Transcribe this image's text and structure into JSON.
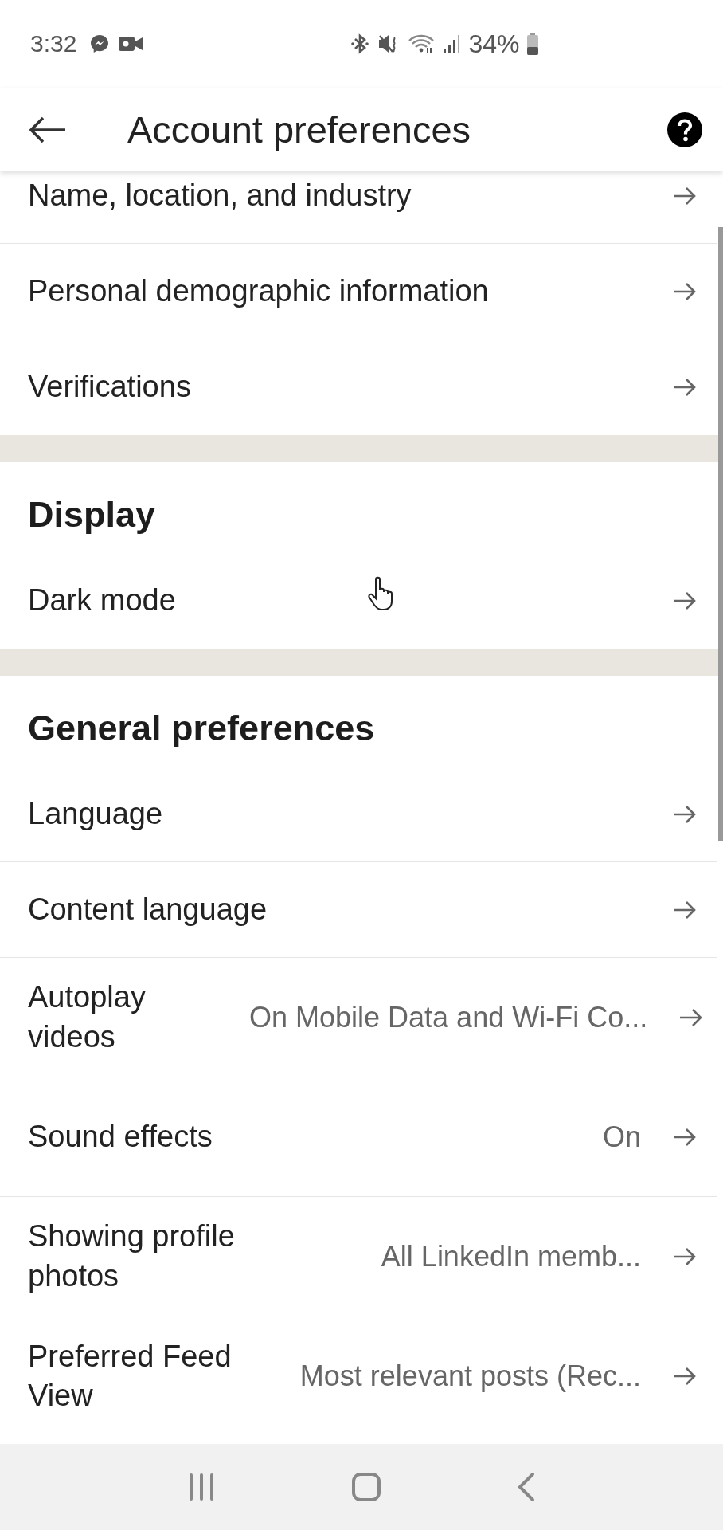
{
  "status_bar": {
    "time": "3:32",
    "battery": "34%"
  },
  "header": {
    "title": "Account preferences"
  },
  "sections": [
    {
      "items": [
        {
          "label": "Name, location, and industry"
        },
        {
          "label": "Personal demographic information"
        },
        {
          "label": "Verifications"
        }
      ]
    },
    {
      "heading": "Display",
      "items": [
        {
          "label": "Dark mode"
        }
      ]
    },
    {
      "heading": "General preferences",
      "items": [
        {
          "label": "Language"
        },
        {
          "label": "Content language"
        },
        {
          "label": "Autoplay videos",
          "value": "On Mobile Data and Wi-Fi Co..."
        },
        {
          "label": "Sound effects",
          "value": "On"
        },
        {
          "label": "Showing profile photos",
          "value": "All LinkedIn memb..."
        },
        {
          "label": "Preferred Feed View",
          "value": "Most relevant posts (Rec..."
        }
      ]
    }
  ]
}
